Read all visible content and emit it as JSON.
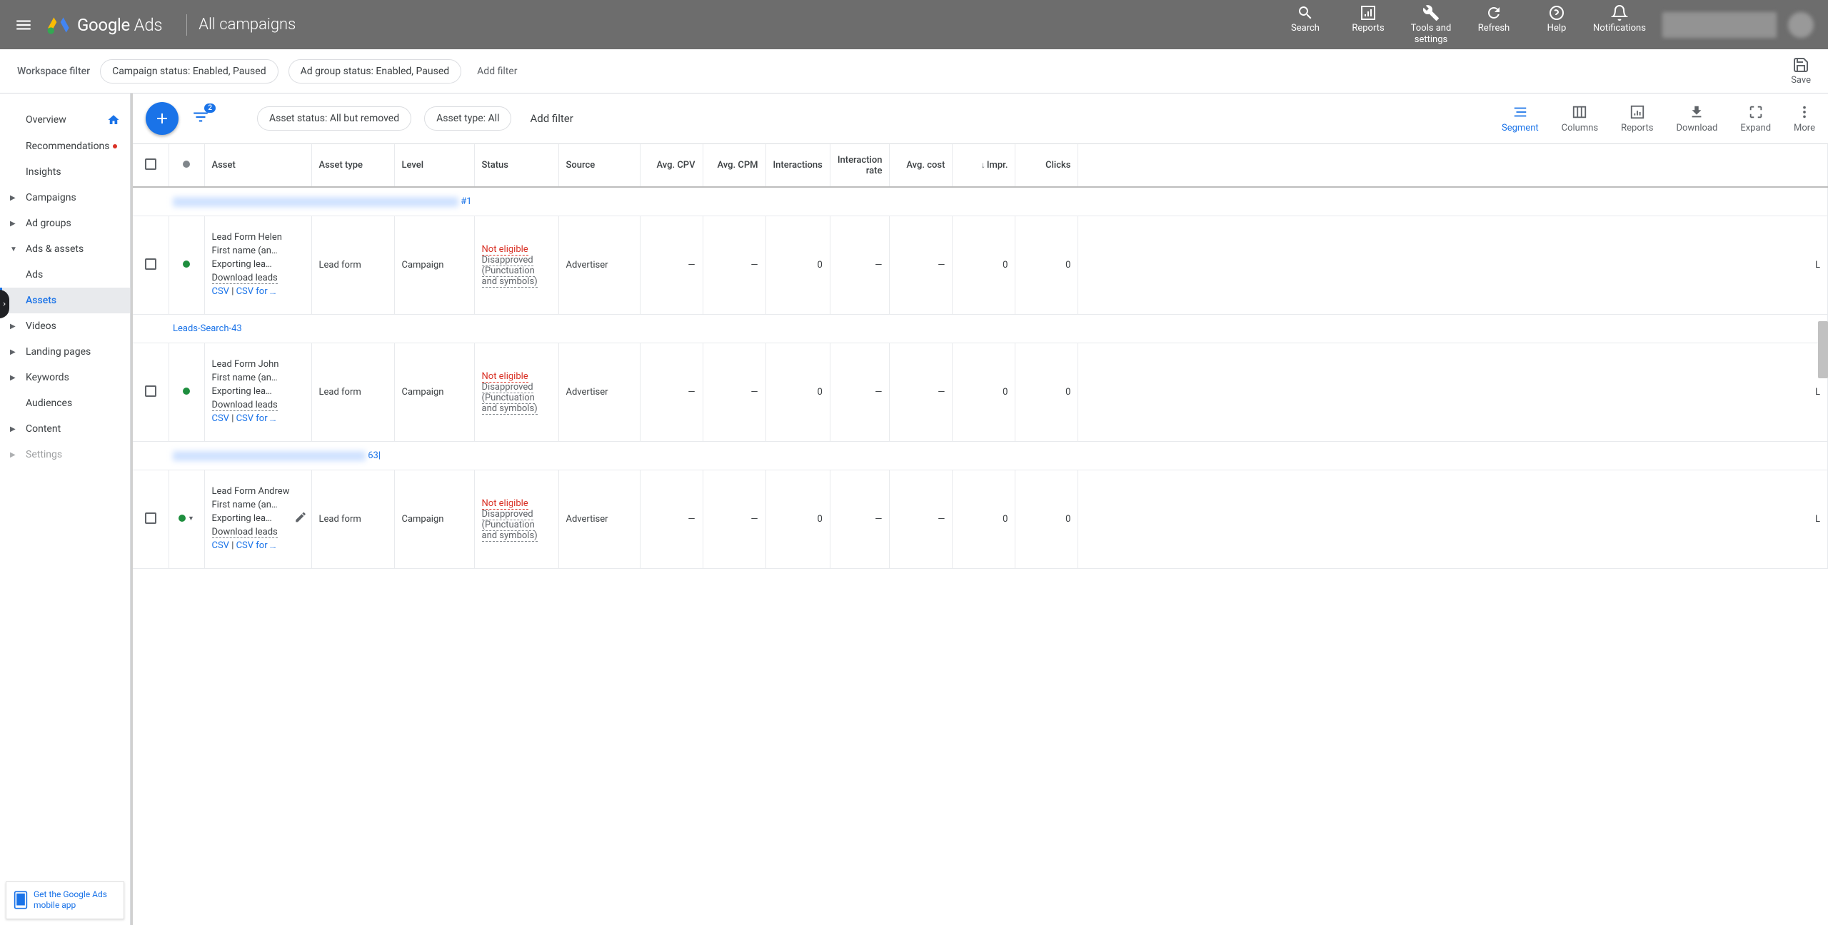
{
  "header": {
    "brand": "Google",
    "brand2": "Ads",
    "campaign": "All campaigns",
    "tools": {
      "search": "Search",
      "reports": "Reports",
      "tools": "Tools and settings",
      "refresh": "Refresh",
      "help": "Help",
      "notifications": "Notifications"
    }
  },
  "wf": {
    "label": "Workspace filter",
    "chip1": "Campaign status: Enabled, Paused",
    "chip2": "Ad group status: Enabled, Paused",
    "add": "Add filter",
    "save": "Save"
  },
  "sidebar": {
    "overview": "Overview",
    "recommendations": "Recommendations",
    "insights": "Insights",
    "campaigns": "Campaigns",
    "adgroups": "Ad groups",
    "adsassets": "Ads & assets",
    "ads": "Ads",
    "assets": "Assets",
    "videos": "Videos",
    "landing": "Landing pages",
    "keywords": "Keywords",
    "audiences": "Audiences",
    "content": "Content",
    "settings": "Settings"
  },
  "promo": "Get the Google Ads mobile app",
  "toolbar": {
    "filter_count": "2",
    "chip1": "Asset status: All but removed",
    "chip2": "Asset type: All",
    "add": "Add filter",
    "segment": "Segment",
    "columns": "Columns",
    "reports": "Reports",
    "download": "Download",
    "expand": "Expand",
    "more": "More"
  },
  "cols": {
    "asset": "Asset",
    "type": "Asset type",
    "level": "Level",
    "status": "Status",
    "source": "Source",
    "avgcpv": "Avg. CPV",
    "avgcpm": "Avg. CPM",
    "interactions": "Interactions",
    "intrate": "Interaction rate",
    "avgcost": "Avg. cost",
    "impr": "Impr.",
    "clicks": "Clicks"
  },
  "groups": {
    "g1_suffix": "#1",
    "g2": "Leads-Search-43",
    "g3_suffix": "63|"
  },
  "rows": [
    {
      "title": "Lead Form Helen",
      "field": "First name (an…",
      "export": "Exporting lea…",
      "download": "Download leads",
      "csv": "CSV",
      "sep": " | ",
      "csv2": "CSV for …",
      "type": "Lead form",
      "level": "Campaign",
      "st1": "Not eligible",
      "st2": "Disapproved",
      "st3": "(Punctuation and symbols)",
      "source": "Advertiser",
      "avgcpv": "—",
      "avgcpm": "—",
      "interactions": "0",
      "intrate": "—",
      "avgcost": "—",
      "impr": "0",
      "clicks": "0"
    },
    {
      "title": "Lead Form John",
      "field": "First name (an…",
      "export": "Exporting lea…",
      "download": "Download leads",
      "csv": "CSV",
      "sep": " | ",
      "csv2": "CSV for …",
      "type": "Lead form",
      "level": "Campaign",
      "st1": "Not eligible",
      "st2": "Disapproved",
      "st3": "(Punctuation and symbols)",
      "source": "Advertiser",
      "avgcpv": "—",
      "avgcpm": "—",
      "interactions": "0",
      "intrate": "—",
      "avgcost": "—",
      "impr": "0",
      "clicks": "0"
    },
    {
      "title": "Lead Form Andrew",
      "field": "First name (an…",
      "export": "Exporting lea…",
      "download": "Download leads",
      "csv": "CSV",
      "sep": " | ",
      "csv2": "CSV for …",
      "type": "Lead form",
      "level": "Campaign",
      "st1": "Not eligible",
      "st2": "Disapproved",
      "st3": "(Punctuation and symbols)",
      "source": "Advertiser",
      "avgcpv": "—",
      "avgcpm": "—",
      "interactions": "0",
      "intrate": "—",
      "avgcost": "—",
      "impr": "0",
      "clicks": "0"
    }
  ]
}
